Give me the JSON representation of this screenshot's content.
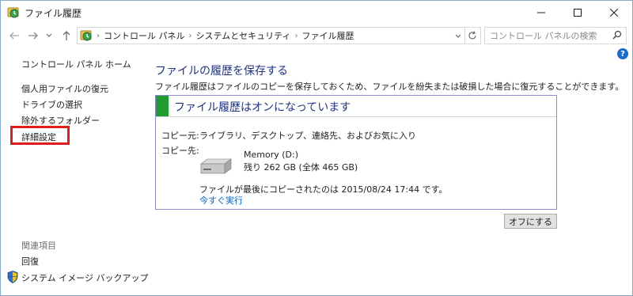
{
  "window": {
    "title": "ファイル履歴"
  },
  "address": {
    "crumbs": [
      "コントロール パネル",
      "システムとセキュリティ",
      "ファイル履歴"
    ]
  },
  "search": {
    "placeholder": "コントロール パネルの検索"
  },
  "sidebar": {
    "home": "コントロール パネル ホーム",
    "items": [
      {
        "label": "個人用ファイルの復元"
      },
      {
        "label": "ドライブの選択"
      },
      {
        "label": "除外するフォルダー"
      },
      {
        "label": "詳細設定"
      }
    ],
    "see_also_title": "関連項目",
    "see_also": [
      {
        "label": "回復"
      },
      {
        "label": "システム イメージ バックアップ"
      }
    ]
  },
  "main": {
    "title": "ファイルの履歴を保存する",
    "description": "ファイル履歴はファイルのコピーを保存しておくため、ファイルを紛失または破損した場合に復元することができます。",
    "status": {
      "title": "ファイル履歴はオンになっています",
      "color": "#1f9c33"
    },
    "copy_from_label": "コピー元:",
    "copy_from_value": "ライブラリ、デスクトップ、連絡先、およびお気に入り",
    "copy_to_label": "コピー先:",
    "drive_name": "Memory (D:)",
    "drive_space": "残り 262 GB (全体 465 GB)",
    "last_copy": "ファイルが最後にコピーされたのは 2015/08/24 17:44 です。",
    "run_now": "今すぐ実行",
    "off_button": "オフにする"
  },
  "colors": {
    "link": "#0066cc",
    "heading": "#1e3287",
    "highlight": "#e21b1b"
  }
}
